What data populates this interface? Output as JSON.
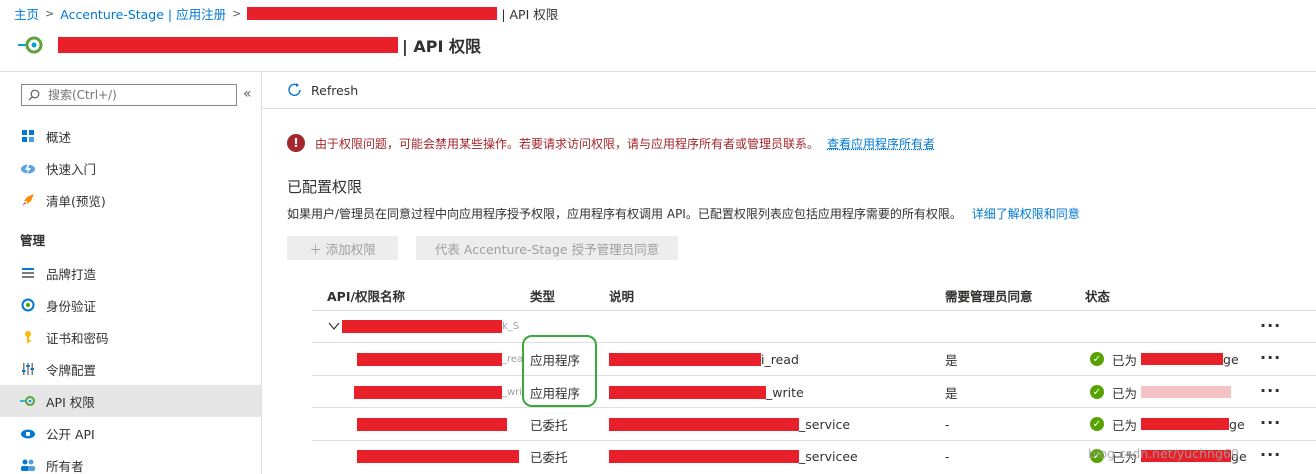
{
  "breadcrumb": {
    "home": "主页",
    "app_registration": "Accenture-Stage | 应用注册",
    "current_suffix": "| API 权限"
  },
  "header": {
    "title_suffix": "| API 权限"
  },
  "sidebar": {
    "search_placeholder": "搜索(Ctrl+/)",
    "collapse_glyph": "«",
    "items_top": [
      {
        "label": "概述",
        "icon": "grid-icon"
      },
      {
        "label": "快速入门",
        "icon": "cloud-lightning-icon"
      },
      {
        "label": "清单(预览)",
        "icon": "rocket-icon"
      }
    ],
    "section_label": "管理",
    "items_manage": [
      {
        "label": "品牌打造",
        "icon": "branding-list-icon"
      },
      {
        "label": "身份验证",
        "icon": "auth-refresh-icon"
      },
      {
        "label": "证书和密码",
        "icon": "key-icon"
      },
      {
        "label": "令牌配置",
        "icon": "sliders-icon"
      },
      {
        "label": "API 权限",
        "icon": "api-icon",
        "active": true
      },
      {
        "label": "公开 API",
        "icon": "cloud-api-icon"
      },
      {
        "label": "所有者",
        "icon": "owners-icon"
      }
    ]
  },
  "command_bar": {
    "refresh_label": "Refresh"
  },
  "warning": {
    "message": "由于权限问题，可能会禁用某些操作。若要请求访问权限，请与应用程序所有者或管理员联系。",
    "link": "查看应用程序所有者"
  },
  "configured": {
    "title": "已配置权限",
    "description": "如果用户/管理员在同意过程中向应用程序授予权限，应用程序有权调用 API。已配置权限列表应包括应用程序需要的所有权限。",
    "learn_more": "详细了解权限和同意",
    "add_button": "＋ 添加权限",
    "consent_button": "代表 Accenture-Stage 授予管理员同意"
  },
  "table": {
    "headers": {
      "name": "API/权限名称",
      "type": "类型",
      "description": "说明",
      "admin_consent": "需要管理员同意",
      "status": "状态"
    },
    "group": {
      "name_tail": "k_S"
    },
    "rows": [
      {
        "name_tail": "_rea",
        "type": "应用程序",
        "desc_tail": "i_read",
        "admin": "是",
        "status": "已为",
        "status_tail": "ge"
      },
      {
        "name_tail": "_wri",
        "type": "应用程序",
        "desc_tail": "_write",
        "admin": "是",
        "status": "已为",
        "status_tail": ""
      },
      {
        "name_tail": "",
        "type": "已委托",
        "desc_tail": "_service",
        "admin": "-",
        "status": "已为",
        "status_tail": "ge"
      },
      {
        "name_tail": "",
        "type": "已委托",
        "desc_tail": "_servicee",
        "admin": "-",
        "status": "已为",
        "status_tail": "ge"
      }
    ],
    "more_glyph": "···"
  },
  "watermark": "blog.csdn.net/yuchng60",
  "colors": {
    "link": "#0078d4",
    "error": "#a4262c",
    "success": "#57a300",
    "redaction": "#e8202a",
    "highlight": "#3aa83a"
  }
}
